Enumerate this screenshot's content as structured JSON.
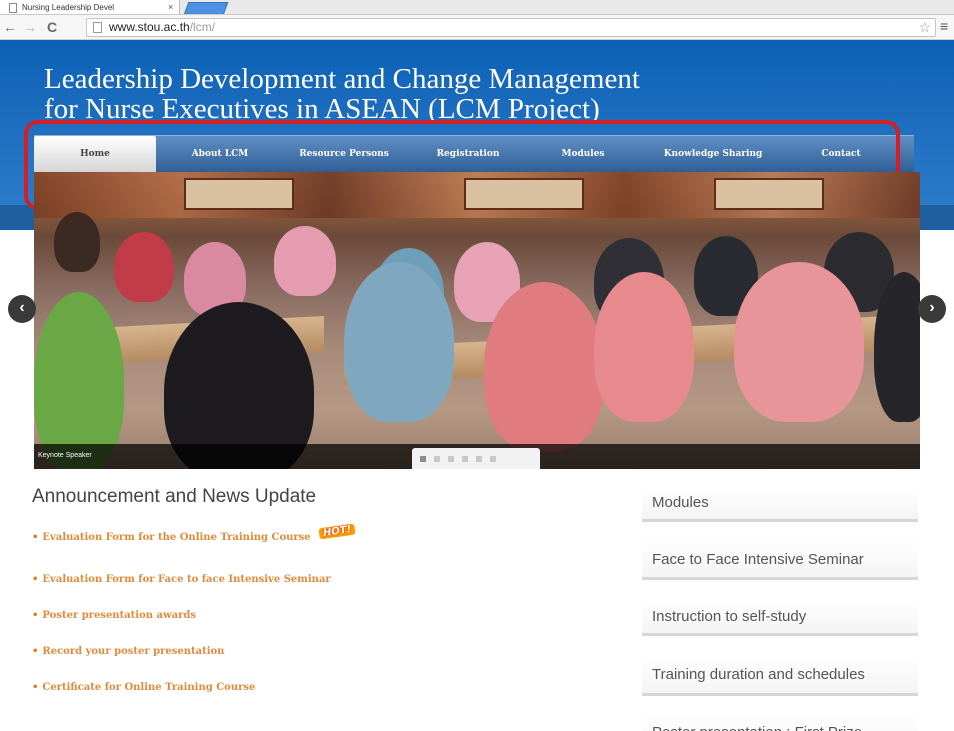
{
  "browser": {
    "tab_title": "Nursing Leadership Devel",
    "tab_close": "×",
    "url_host": "www.stou.ac.th",
    "url_path": "/lcm/",
    "back": "←",
    "forward": "→",
    "reload": "C",
    "star": "☆",
    "menu": "≡"
  },
  "site": {
    "title_line1": "Leadership Development and Change Management",
    "title_line2": "for Nurse Executives in ASEAN (LCM Project)"
  },
  "nav": {
    "items": [
      {
        "label": "Home"
      },
      {
        "label": "About LCM"
      },
      {
        "label": "Resource Persons"
      },
      {
        "label": "Registration"
      },
      {
        "label": "Modules"
      },
      {
        "label": "Knowledge Sharing"
      },
      {
        "label": "Contact"
      }
    ]
  },
  "slider": {
    "caption": "Keynote Speaker",
    "prev": "‹",
    "next": "›",
    "dot_count": 6,
    "active_dot": 1
  },
  "news": {
    "heading": "Announcement and News Update",
    "bullet": "•",
    "hot_label": "HOT!",
    "items": [
      {
        "label": "Evaluation Form for the Online Training Course"
      },
      {
        "label": "Evaluation Form for Face to face Intensive Seminar"
      },
      {
        "label": "Poster presentation awards"
      },
      {
        "label": "Record your poster presentation"
      },
      {
        "label": "Certificate for Online Training Course"
      }
    ]
  },
  "sidebar": {
    "items": [
      {
        "label": "Modules"
      },
      {
        "label": "Face to Face Intensive Seminar"
      },
      {
        "label": "Instruction to self-study"
      },
      {
        "label": "Training duration and schedules"
      },
      {
        "label": "Poster presentation : First Prize"
      }
    ]
  },
  "colors": {
    "banner": "#1f6ec0",
    "highlight": "#d22027",
    "link": "#e08a3b"
  }
}
